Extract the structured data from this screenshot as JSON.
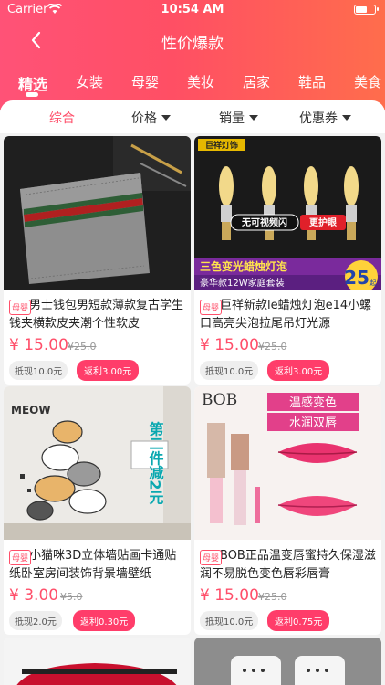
{
  "status": {
    "carrier": "Carrier",
    "time": "10:54 AM"
  },
  "nav": {
    "title": "性价爆款"
  },
  "categories": [
    "精选",
    "女装",
    "母婴",
    "美妆",
    "居家",
    "鞋品",
    "美食"
  ],
  "sort": {
    "default": "综合",
    "price": "价格",
    "sales": "销量",
    "coupon": "优惠券"
  },
  "products": [
    {
      "tag": "母婴",
      "title": "男士钱包男短款薄款复古学生钱夹横款皮夹潮个性软皮",
      "price": "¥ 15.00",
      "original": "¥25.0",
      "cash_back": "抵现10.0元",
      "rebate": "返利3.00元"
    },
    {
      "tag": "母婴",
      "title": "巨祥新款le蜡烛灯泡e14小螺口高亮尖泡拉尾吊灯光源",
      "price": "¥ 15.00",
      "original": "¥25.0",
      "cash_back": "抵现10.0元",
      "rebate": "返利3.00元",
      "image_text": {
        "brand": "巨祥灯饰",
        "overlay1": "无可视频闪",
        "overlay2": "更护眼",
        "banner": "三色变光蜡烛灯泡",
        "package": "豪华款12W家庭套装",
        "badge_num": "25",
        "badge_unit": "起"
      }
    },
    {
      "tag": "母婴",
      "title": "小猫咪3D立体墙贴画卡通贴纸卧室房间装饰背景墙壁纸",
      "price": "¥ 3.00",
      "original": "¥5.0",
      "cash_back": "抵现2.0元",
      "rebate": "返利0.30元",
      "image_text": {
        "meow": "MEOW",
        "promo": "第二件减2元"
      }
    },
    {
      "tag": "母婴",
      "title": "BOB正品温变唇蜜持久保湿滋润不易脱色变色唇彩唇膏",
      "price": "¥ 15.00",
      "original": "¥25.0",
      "cash_back": "抵现10.0元",
      "rebate": "返利0.75元",
      "image_text": {
        "brand": "BOB",
        "label1": "温感变色",
        "label2": "水润双唇"
      }
    }
  ],
  "colors": {
    "accent": "#ff4f6a",
    "header_start": "#ff5277",
    "header_end": "#ff6d4c",
    "rebate_bg": "#ff3d6a"
  }
}
